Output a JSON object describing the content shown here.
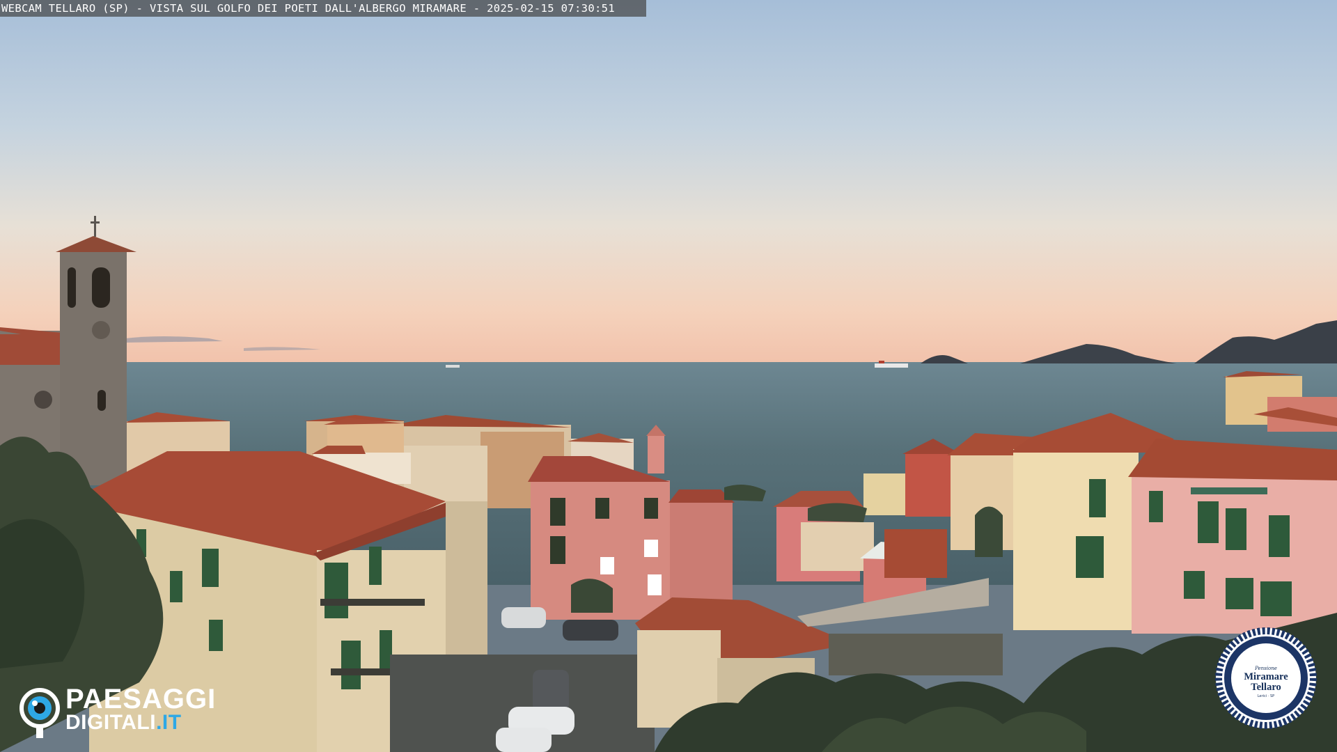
{
  "caption": "WEBCAM TELLARO (SP) - VISTA SUL GOLFO DEI POETI DALL'ALBERGO MIRAMARE - 2025-02-15 07:30:51",
  "watermark": {
    "line1": "PAESAGGI",
    "line2_main": "DIGITALI",
    "line2_accent": ".IT",
    "accent_color": "#2ea8e6",
    "icon": "eye-icon"
  },
  "seal": {
    "top": "Pensione",
    "line1": "Miramare",
    "line2": "Tellaro",
    "bottom": "Lerici · SP",
    "ring_color": "#1c3566"
  },
  "colors": {
    "sky_top": "#a9bfd8",
    "sky_horizon": "#f3c8ae",
    "sea": "#506a72",
    "roof": "#a64b34"
  }
}
